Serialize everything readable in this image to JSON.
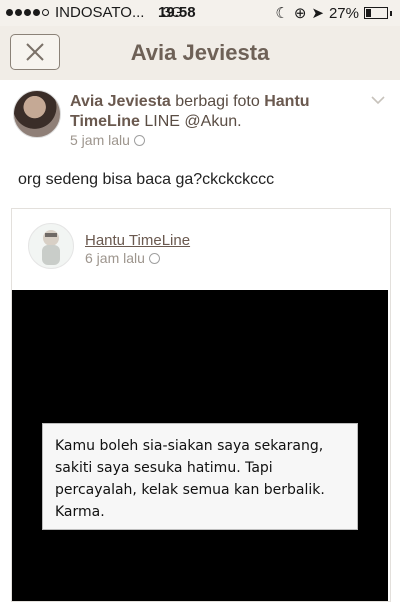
{
  "status": {
    "carrier": "INDOSATO...",
    "network": "3G",
    "time": "19.58",
    "battery": "27%",
    "battery_level": 0.27
  },
  "nav": {
    "title": "Avia Jeviesta"
  },
  "post": {
    "author": "Avia Jeviesta",
    "action": " berbagi foto ",
    "shared_from": "Hantu TimeLine",
    "source_suffix": " LINE @Akun.",
    "time": "5 jam lalu",
    "text": "org sedeng bisa baca ga?ckckckccc"
  },
  "shared": {
    "name": "Hantu TimeLine",
    "time": "6 jam lalu",
    "quote": "Kamu boleh sia-siakan saya sekarang,\nsakiti saya sesuka hatimu. Tapi\npercayalah, kelak semua kan berbalik.\nKarma."
  },
  "icons": {
    "close": "close-icon",
    "chevron": "chevron-down-icon",
    "privacy": "globe-icon"
  }
}
